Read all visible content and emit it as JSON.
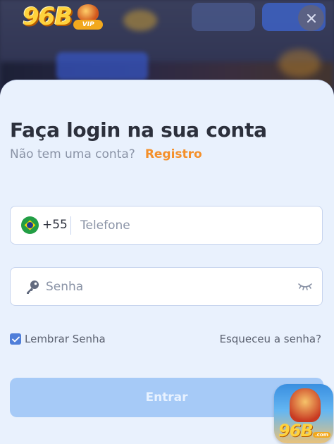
{
  "brand": {
    "logo_text": "96B",
    "logo_badge": "VIP",
    "app_badge_text": "96B",
    "app_badge_sub": ".com"
  },
  "header": {
    "close_icon": "close-icon"
  },
  "login": {
    "title": "Faça login na sua conta",
    "no_account_text": "Não tem uma conta?",
    "register_label": "Registro",
    "phone": {
      "country_flag": "brazil-flag-icon",
      "country_code": "+55",
      "placeholder": "Telefone",
      "value": ""
    },
    "password": {
      "icon": "key-icon",
      "placeholder": "Senha",
      "value": "",
      "toggle_icon": "eye-closed-icon"
    },
    "remember_label": "Lembrar Senha",
    "remember_checked": true,
    "forgot_label": "Esqueceu a senha?",
    "submit_label": "Entrar"
  },
  "colors": {
    "accent_orange": "#f4902b",
    "sheet_bg": "#e9f1fd",
    "button_bg": "#a6caf7",
    "checkbox_blue": "#4f7ed9",
    "title_text": "#2c303c"
  }
}
